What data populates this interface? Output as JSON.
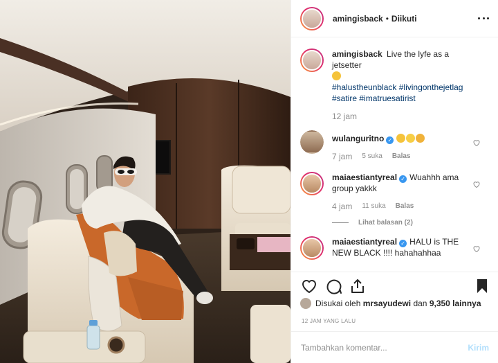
{
  "post": {
    "photo_name": "jet-interior-photo",
    "author": "amingisback",
    "separator": "•",
    "follow_status": "Diikuti"
  },
  "caption": {
    "username": "amingisback",
    "text": "Live the lyfe as a jetsetter",
    "emoji": "tired-face-emoji",
    "hashtags_line1": "#halustheunblack #livingonthejetlag",
    "hashtags_line2": "#satire #imatruesatirist",
    "time": "12 jam"
  },
  "comments": [
    {
      "username": "wulanguritno",
      "verified": true,
      "text": "",
      "emojis": [
        "raising-hands-emoji",
        "joy-emoji",
        "clapping-emoji"
      ],
      "time": "7 jam",
      "likes": "5 suka",
      "reply_label": "Balas"
    },
    {
      "username": "maiaestiantyreal",
      "verified": true,
      "text": "Wuahhh ama group yakkk",
      "time": "4 jam",
      "likes": "11 suka",
      "reply_label": "Balas",
      "view_replies": "Lihat balasan (2)"
    },
    {
      "username": "maiaestiantyreal",
      "verified": true,
      "text": "HALU is THE NEW BLACK !!!! hahahahhaa"
    }
  ],
  "likes": {
    "prefix": "Disukai oleh",
    "user": "mrsayudewi",
    "joiner": "dan",
    "others": "9,350 lainnya"
  },
  "timestamp": "12 JAM YANG LALU",
  "add_comment": {
    "placeholder": "Tambahkan komentar...",
    "post_label": "Kirim"
  },
  "colors": {
    "link": "#003569",
    "verified": "#3897f0",
    "post_disabled": "#b2dffc",
    "muted": "#8e8e8e"
  }
}
